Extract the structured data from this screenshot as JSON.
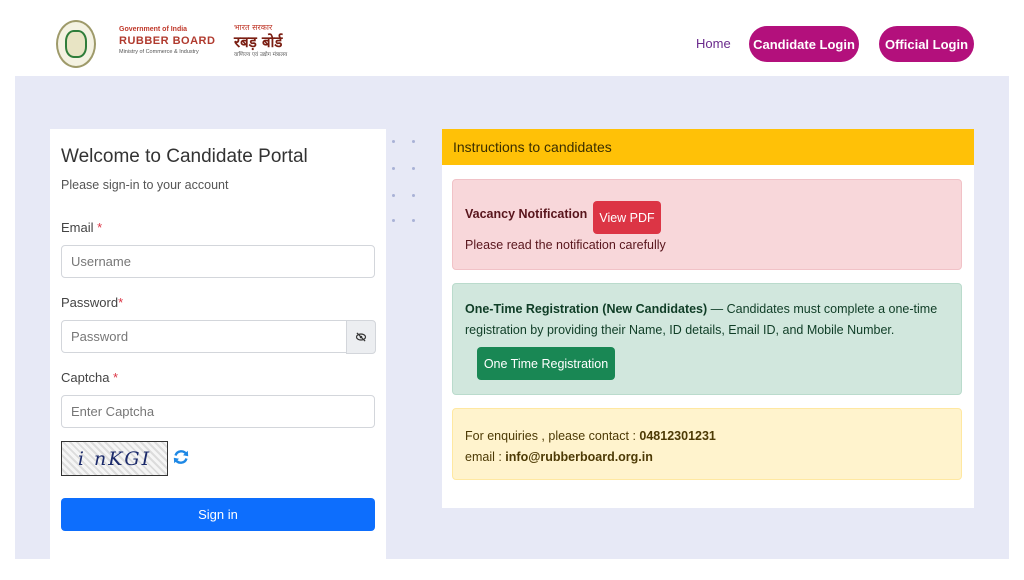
{
  "header": {
    "brand_en": {
      "gov": "Government of India",
      "name": "RUBBER BOARD",
      "ministry": "Ministry of Commerce & Industry"
    },
    "brand_hi": {
      "gov": "भारत सरकार",
      "name": "रबड़ बोर्ड",
      "ministry": "वाणिज्य एवं उद्योग मंत्रालय"
    },
    "nav": {
      "home": "Home",
      "candidate_login": "Candidate Login",
      "official_login": "Official Login"
    }
  },
  "login": {
    "title": "Welcome to Candidate Portal",
    "subtitle": "Please sign-in to your account",
    "email_label": "Email",
    "email_placeholder": "Username",
    "password_label": "Password",
    "password_placeholder": "Password",
    "captcha_label": "Captcha",
    "captcha_placeholder": "Enter Captcha",
    "captcha_text": "i nKGI",
    "required_mark": "*",
    "signin_label": "Sign in"
  },
  "instructions": {
    "title": "Instructions to candidates",
    "vacancy": {
      "title": "Vacancy Notification",
      "button": "View PDF",
      "note": "Please read the notification carefully"
    },
    "otr": {
      "title": "One-Time Registration (New Candidates)",
      "text": " — Candidates must complete a one-time registration by providing their Name, ID details, Email ID, and Mobile Number.",
      "button": "One Time Registration"
    },
    "enquiry": {
      "contact_label": "For enquiries , please contact : ",
      "phone": "04812301231",
      "email_label": "email : ",
      "email": "info@rubberboard.org.in"
    }
  },
  "colors": {
    "accent_pill": "#b3107c",
    "primary": "#0d6efd",
    "warning_header": "#ffc107",
    "danger": "#dc3545",
    "success": "#198754",
    "page_bg": "#e7e9f6"
  },
  "icons": [
    "emblem-logo",
    "eye-slash-icon",
    "refresh-icon"
  ]
}
